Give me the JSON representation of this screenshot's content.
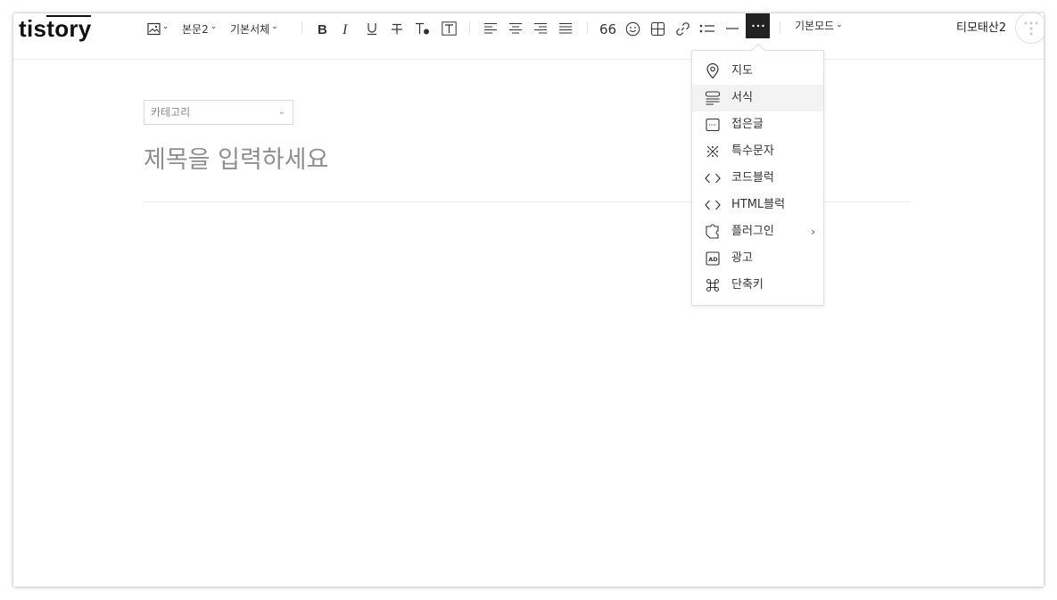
{
  "brand": {
    "logo_text": "tistory"
  },
  "toolbar": {
    "image_button_chevron": "⌄",
    "paragraph_style": "본문2",
    "font_family": "기본서체",
    "mode": "기본모드",
    "more_label": "···"
  },
  "user": {
    "name": "티모태산2"
  },
  "editor": {
    "category_placeholder": "카테고리",
    "category_chevron": "⌄",
    "title_placeholder": "제목을 입력하세요"
  },
  "more_menu": {
    "items": [
      {
        "label": "지도",
        "icon": "map-pin-icon"
      },
      {
        "label": "서식",
        "icon": "template-icon"
      },
      {
        "label": "접은글",
        "icon": "folded-text-icon"
      },
      {
        "label": "특수문자",
        "icon": "special-char-icon"
      },
      {
        "label": "코드블럭",
        "icon": "code-icon"
      },
      {
        "label": "HTML블럭",
        "icon": "html-code-icon"
      },
      {
        "label": "플러그인",
        "icon": "plugin-icon",
        "submenu_arrow": "›"
      },
      {
        "label": "광고",
        "icon": "ad-icon"
      },
      {
        "label": "단축키",
        "icon": "command-icon"
      }
    ],
    "highlighted_item": "서식"
  },
  "colors": {
    "more_button_bg": "#222222",
    "menu_hover_bg": "#f3f3f3",
    "placeholder_text": "#8f8f8f"
  }
}
